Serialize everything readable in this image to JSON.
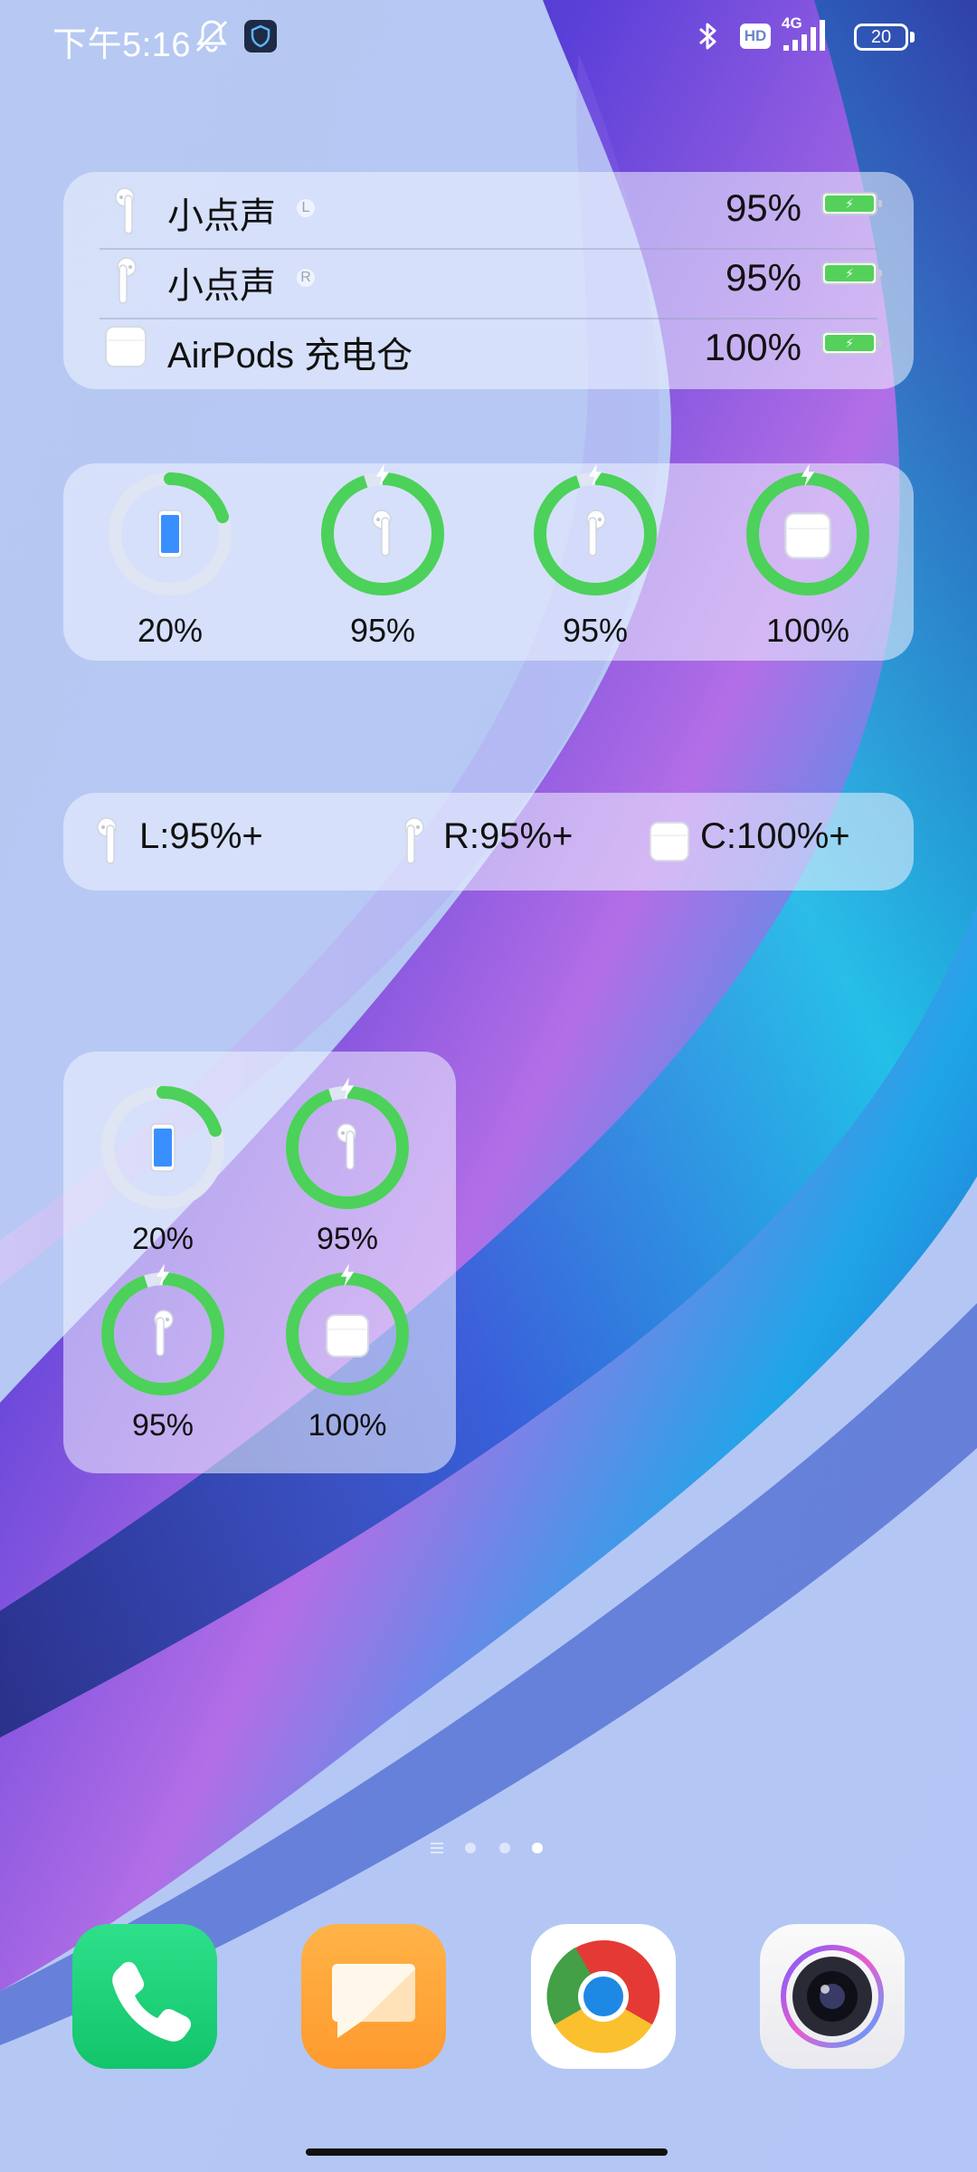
{
  "status_bar": {
    "time": "下午5:16",
    "network": "4G",
    "hd_label": "HD",
    "battery_level": "20",
    "icons": [
      "bell-muted-icon",
      "shield-app-icon",
      "bluetooth-icon",
      "hd-icon",
      "signal-icon",
      "battery-icon"
    ]
  },
  "list_widget": {
    "rows": [
      {
        "name": "小点声",
        "badge": "L",
        "percent": "95%",
        "icon": "left-airpod-icon"
      },
      {
        "name": "小点声",
        "badge": "R",
        "percent": "95%",
        "icon": "right-airpod-icon"
      },
      {
        "name": "AirPods 充电仓",
        "badge": "",
        "percent": "100%",
        "icon": "charging-case-icon"
      }
    ]
  },
  "ring_widget_wide": {
    "items": [
      {
        "label": "20%",
        "level": 0.2,
        "charging": false,
        "icon": "phone-icon"
      },
      {
        "label": "95%",
        "level": 0.95,
        "charging": true,
        "icon": "left-airpod-icon"
      },
      {
        "label": "95%",
        "level": 0.95,
        "charging": true,
        "icon": "right-airpod-icon"
      },
      {
        "label": "100%",
        "level": 1.0,
        "charging": true,
        "icon": "charging-case-icon"
      }
    ]
  },
  "inline_widget": {
    "items": [
      {
        "text": "L:95%+",
        "icon": "left-airpod-icon"
      },
      {
        "text": "R:95%+",
        "icon": "right-airpod-icon"
      },
      {
        "text": "C:100%+",
        "icon": "charging-case-icon"
      }
    ]
  },
  "ring_widget_grid": {
    "items": [
      {
        "label": "20%",
        "level": 0.2,
        "charging": false,
        "icon": "phone-icon"
      },
      {
        "label": "95%",
        "level": 0.95,
        "charging": true,
        "icon": "left-airpod-icon"
      },
      {
        "label": "95%",
        "level": 0.95,
        "charging": true,
        "icon": "right-airpod-icon"
      },
      {
        "label": "100%",
        "level": 1.0,
        "charging": true,
        "icon": "charging-case-icon"
      }
    ]
  },
  "page_indicator": {
    "pages": 3,
    "active_index": 2
  },
  "dock": {
    "apps": [
      {
        "icon": "phone-app-icon",
        "color": "#22d07a"
      },
      {
        "icon": "messages-app-icon",
        "color": "#ffa53a"
      },
      {
        "icon": "chrome-app-icon",
        "color": "#ffffff"
      },
      {
        "icon": "camera-app-icon",
        "color": "#f3f3f5"
      }
    ]
  },
  "colors": {
    "ring_green": "#4cd15a",
    "ring_track": "#dfe5f2",
    "phone_blue": "#3a8fff"
  }
}
